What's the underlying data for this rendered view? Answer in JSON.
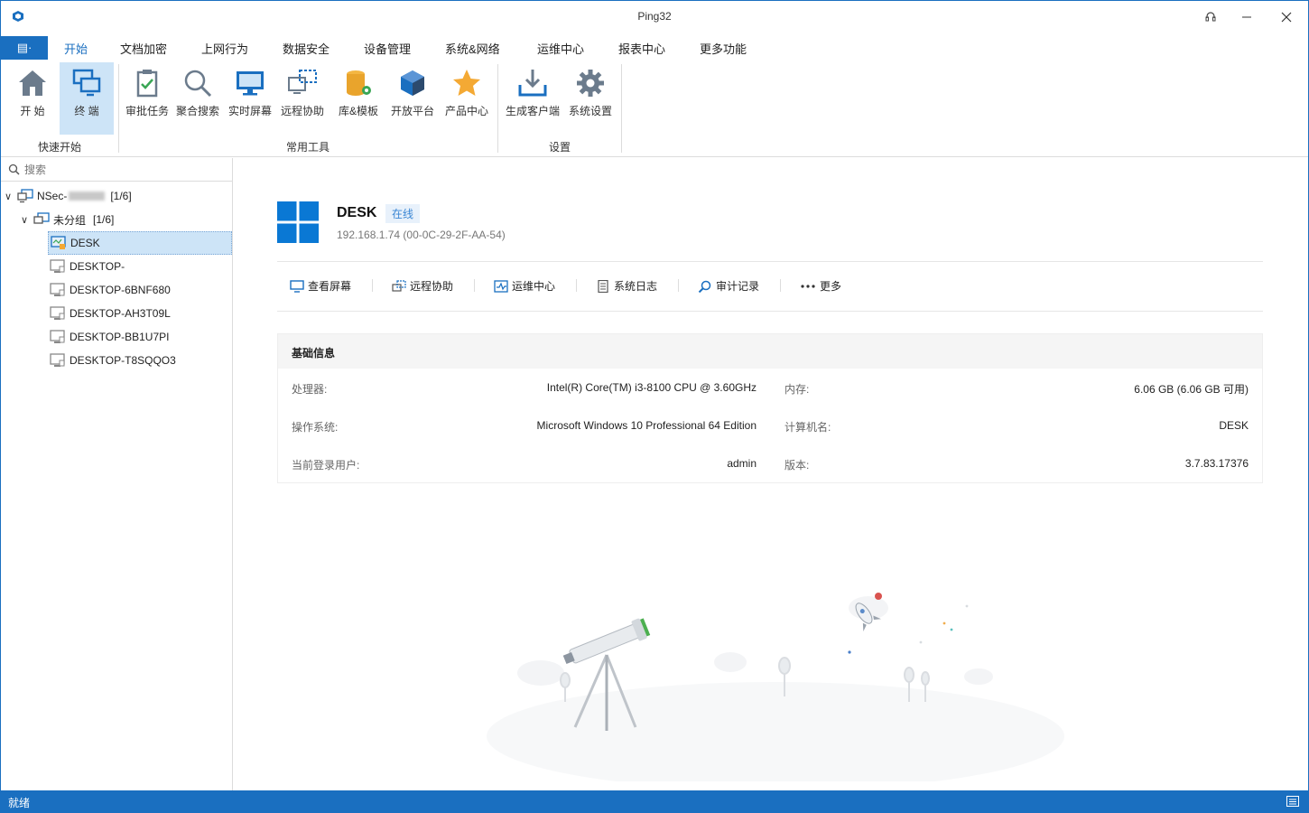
{
  "window": {
    "title": "Ping32"
  },
  "menu": {
    "app_menu_label": "▤·",
    "tabs": [
      "开始",
      "文档加密",
      "上网行为",
      "数据安全",
      "设备管理",
      "系统&网络",
      "运维中心",
      "报表中心",
      "更多功能"
    ],
    "active_tab": "开始"
  },
  "ribbon": {
    "buttons": [
      "开 始",
      "终 端",
      "审批任务",
      "聚合搜索",
      "实时屏幕",
      "远程协助",
      "库&模板",
      "开放平台",
      "产品中心",
      "生成客户端",
      "系统设置"
    ],
    "groups": [
      "快速开始",
      "常用工具",
      "设置"
    ],
    "selected_button": "终 端"
  },
  "search": {
    "placeholder": "搜索"
  },
  "tree": {
    "root": {
      "name_prefix": "NSec-",
      "count": "[1/6]"
    },
    "group": {
      "name": "未分组",
      "count": "[1/6]"
    },
    "terminals": [
      "DESK",
      "DESKTOP-",
      "DESKTOP-6BNF680",
      "DESKTOP-AH3T09L",
      "DESKTOP-BB1U7PI",
      "DESKTOP-T8SQQO3"
    ],
    "selected": "DESK"
  },
  "host": {
    "name": "DESK",
    "status": "在线",
    "ip_mac": "192.168.1.74  (00-0C-29-2F-AA-54)"
  },
  "actions": [
    "查看屏幕",
    "远程协助",
    "运维中心",
    "系统日志",
    "审计记录",
    "更多"
  ],
  "info": {
    "title": "基础信息",
    "rows": [
      {
        "l1": "处理器:",
        "v1": "Intel(R) Core(TM) i3-8100 CPU @ 3.60GHz",
        "l2": "内存:",
        "v2": "6.06 GB (6.06 GB 可用)"
      },
      {
        "l1": "操作系统:",
        "v1": "Microsoft Windows 10 Professional 64 Edition",
        "l2": "计算机名:",
        "v2": "DESK"
      },
      {
        "l1": "当前登录用户:",
        "v1": "admin",
        "l2": "版本:",
        "v2": "3.7.83.17376"
      }
    ]
  },
  "statusbar": {
    "text": "就绪"
  },
  "colors": {
    "accent": "#1a6fc0",
    "selection": "#cde4f7",
    "online_badge_bg": "#e8f1fb"
  }
}
